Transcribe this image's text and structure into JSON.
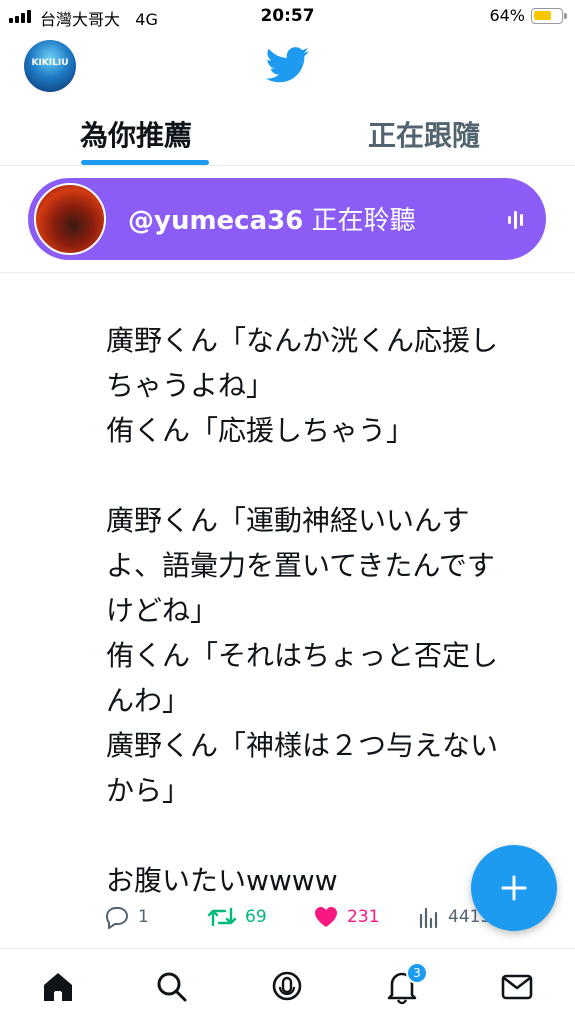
{
  "status_bar": {
    "carrier": "台灣大哥大",
    "network": "4G",
    "time": "20:57",
    "battery_percent": "64%",
    "battery_level": 0.64
  },
  "header": {
    "account_avatar_label": "KIKILIU",
    "logo_icon": "twitter-bird-icon"
  },
  "tabs": [
    {
      "label": "為你推薦",
      "active": true
    },
    {
      "label": "正在跟隨",
      "active": false
    }
  ],
  "space_card": {
    "username": "@yumeca36",
    "status": "正在聆聽",
    "background_color": "#8b5cf6"
  },
  "tweet": {
    "lines": [
      "廣野くん「なんか洸くん応援し",
      "ちゃうよね」",
      "侑くん「応援しちゃう」",
      "",
      "廣野くん「運動神経いいんす",
      "よ、語彙力を置いてきたんです",
      "けどね」",
      "侑くん「それはちょっと否定し",
      "んわ」",
      "廣野くん「神様は２つ与えない",
      "から」",
      "",
      "お腹いたいwwww"
    ],
    "replies": "1",
    "retweets": "69",
    "likes": "231",
    "views": "4415"
  },
  "nav": {
    "items": [
      "home-icon",
      "search-icon",
      "spaces-icon",
      "notifications-icon",
      "messages-icon"
    ],
    "notification_badge": "3"
  },
  "colors": {
    "accent": "#1d9bf0",
    "retweet": "#00ba7c",
    "like": "#f91880"
  }
}
